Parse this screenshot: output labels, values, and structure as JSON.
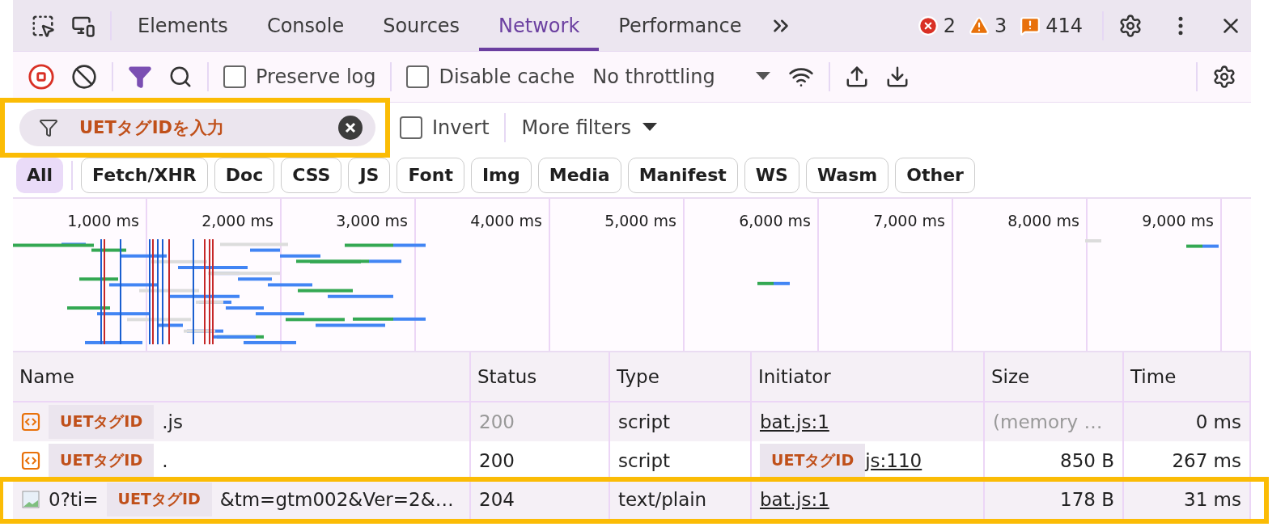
{
  "tabs": [
    {
      "label": "Elements",
      "selected": false
    },
    {
      "label": "Console",
      "selected": false
    },
    {
      "label": "Sources",
      "selected": false
    },
    {
      "label": "Network",
      "selected": true
    },
    {
      "label": "Performance",
      "selected": false
    }
  ],
  "counters": [
    {
      "kind": "error",
      "count": "2"
    },
    {
      "kind": "warning",
      "count": "3"
    },
    {
      "kind": "issue",
      "count": "414"
    }
  ],
  "toolbar": {
    "recording": true,
    "preserve_log": {
      "label": "Preserve log",
      "checked": false
    },
    "disable_cache": {
      "label": "Disable cache",
      "checked": false
    },
    "throttling": "No throttling"
  },
  "filter": {
    "value": "UETタグIDを入力",
    "highlighted": true,
    "invert": {
      "label": "Invert",
      "checked": false
    },
    "more_filters": "More filters"
  },
  "type_filters": [
    {
      "label": "All",
      "selected": true
    },
    {
      "label": "Fetch/XHR",
      "selected": false
    },
    {
      "label": "Doc",
      "selected": false
    },
    {
      "label": "CSS",
      "selected": false
    },
    {
      "label": "JS",
      "selected": false
    },
    {
      "label": "Font",
      "selected": false
    },
    {
      "label": "Img",
      "selected": false
    },
    {
      "label": "Media",
      "selected": false
    },
    {
      "label": "Manifest",
      "selected": false
    },
    {
      "label": "WS",
      "selected": false
    },
    {
      "label": "Wasm",
      "selected": false
    },
    {
      "label": "Other",
      "selected": false
    }
  ],
  "overview": {
    "ticks": [
      "1,000 ms",
      "2,000 ms",
      "3,000 ms",
      "4,000 ms",
      "5,000 ms",
      "6,000 ms",
      "7,000 ms",
      "8,000 ms",
      "9,000 ms"
    ]
  },
  "table": {
    "columns": [
      "Name",
      "Status",
      "Type",
      "Initiator",
      "Size",
      "Time"
    ],
    "rows": [
      {
        "kind": "script",
        "name": {
          "mask": "UETタグID",
          "suffix": ".js"
        },
        "status": "200",
        "status_dim": true,
        "type": "script",
        "initiator": {
          "text": "bat.js:1"
        },
        "size": "(memory …",
        "size_dim": true,
        "time": "0 ms",
        "highlighted": false
      },
      {
        "kind": "script",
        "name": {
          "mask": "UETタグID",
          "suffix": "."
        },
        "status": "200",
        "status_dim": false,
        "type": "script",
        "initiator": {
          "mask": "UETタグID",
          "text": "js:110"
        },
        "size": "850 B",
        "size_dim": false,
        "time": "267 ms",
        "highlighted": false
      },
      {
        "kind": "image",
        "name": {
          "prefix": "0?ti=",
          "mask": "UETタグID",
          "suffix": "&tm=gtm002&Ver=2&…"
        },
        "status": "204",
        "status_dim": false,
        "type": "text/plain",
        "initiator": {
          "text": "bat.js:1"
        },
        "size": "178 B",
        "size_dim": false,
        "time": "31 ms",
        "highlighted": true
      }
    ]
  }
}
